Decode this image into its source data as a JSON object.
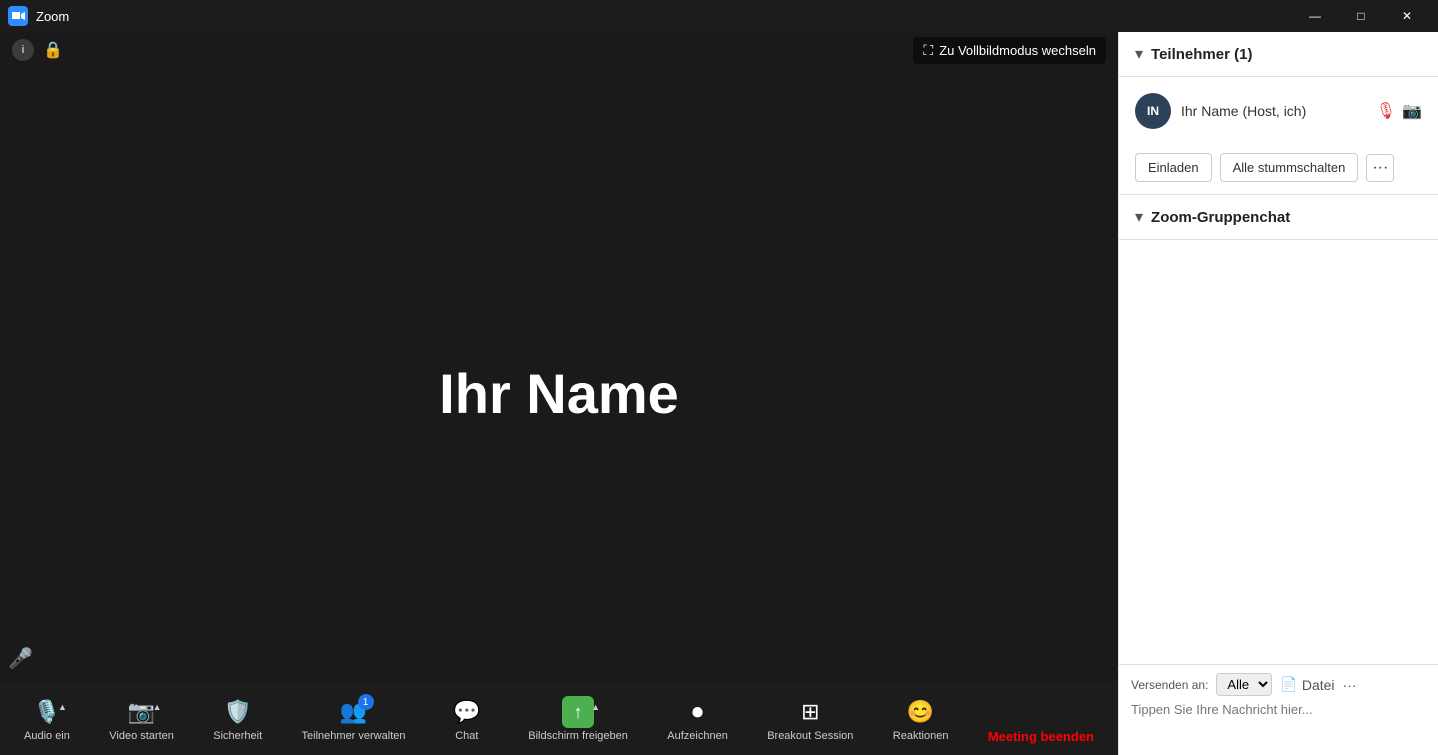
{
  "titlebar": {
    "title": "Zoom",
    "minimize_label": "—",
    "maximize_label": "□",
    "close_label": "✕"
  },
  "video_area": {
    "fullscreen_button": "Zu Vollbildmodus wechseln",
    "participant_name": "Ihr Name"
  },
  "toolbar": {
    "audio_label": "Audio ein",
    "video_label": "Video starten",
    "security_label": "Sicherheit",
    "participants_label": "Teilnehmer verwalten",
    "participants_count": "1",
    "chat_label": "Chat",
    "share_label": "Bildschirm freigeben",
    "record_label": "Aufzeichnen",
    "breakout_label": "Breakout Session",
    "reactions_label": "Reaktionen",
    "end_label": "Meeting beenden"
  },
  "right_panel": {
    "participants": {
      "title": "Teilnehmer (1)",
      "items": [
        {
          "initials": "IN",
          "name": "Ihr Name (Host, ich)"
        }
      ],
      "invite_button": "Einladen",
      "mute_all_button": "Alle stummschalten"
    },
    "chat": {
      "title": "Zoom-Gruppenchat",
      "send_to_label": "Versenden an:",
      "send_to_value": "Alle",
      "file_label": "Datei",
      "input_placeholder": "Tippen Sie Ihre Nachricht hier..."
    }
  }
}
